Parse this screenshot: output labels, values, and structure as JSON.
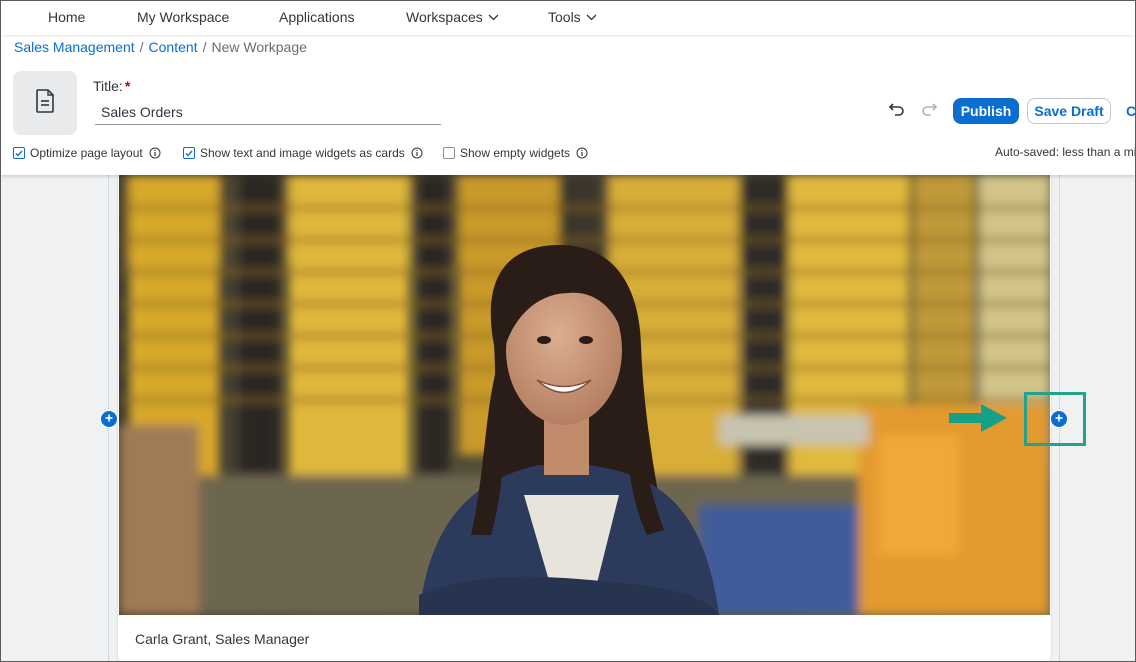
{
  "topnav": {
    "items": [
      {
        "label": "Home"
      },
      {
        "label": "My Workspace"
      },
      {
        "label": "Applications"
      },
      {
        "label": "Workspaces",
        "has_dropdown": true
      },
      {
        "label": "Tools",
        "has_dropdown": true
      }
    ]
  },
  "breadcrumb": {
    "items": [
      "Sales Management",
      "Content"
    ],
    "current": "New Workpage",
    "separator": "/"
  },
  "page_header": {
    "icon": "document-icon",
    "title_label": "Title:",
    "required_marker": "*",
    "title_value": "Sales Orders"
  },
  "toolbar": {
    "undo_icon": "undo-icon",
    "redo_icon": "redo-icon",
    "publish_label": "Publish",
    "save_draft_label": "Save Draft",
    "overflow_label": "C"
  },
  "options": [
    {
      "label": "Optimize page layout",
      "checked": true
    },
    {
      "label": "Show text and image widgets as cards",
      "checked": true
    },
    {
      "label": "Show empty widgets",
      "checked": false
    }
  ],
  "autosave_text": "Auto-saved: less than a mi",
  "widget": {
    "image_alt": "Smiling woman with arms crossed in a warehouse",
    "caption": "Carla Grant, Sales Manager"
  },
  "colors": {
    "accent": "#0a6ed1",
    "highlight": "#23a38a",
    "required": "#bb0000"
  }
}
